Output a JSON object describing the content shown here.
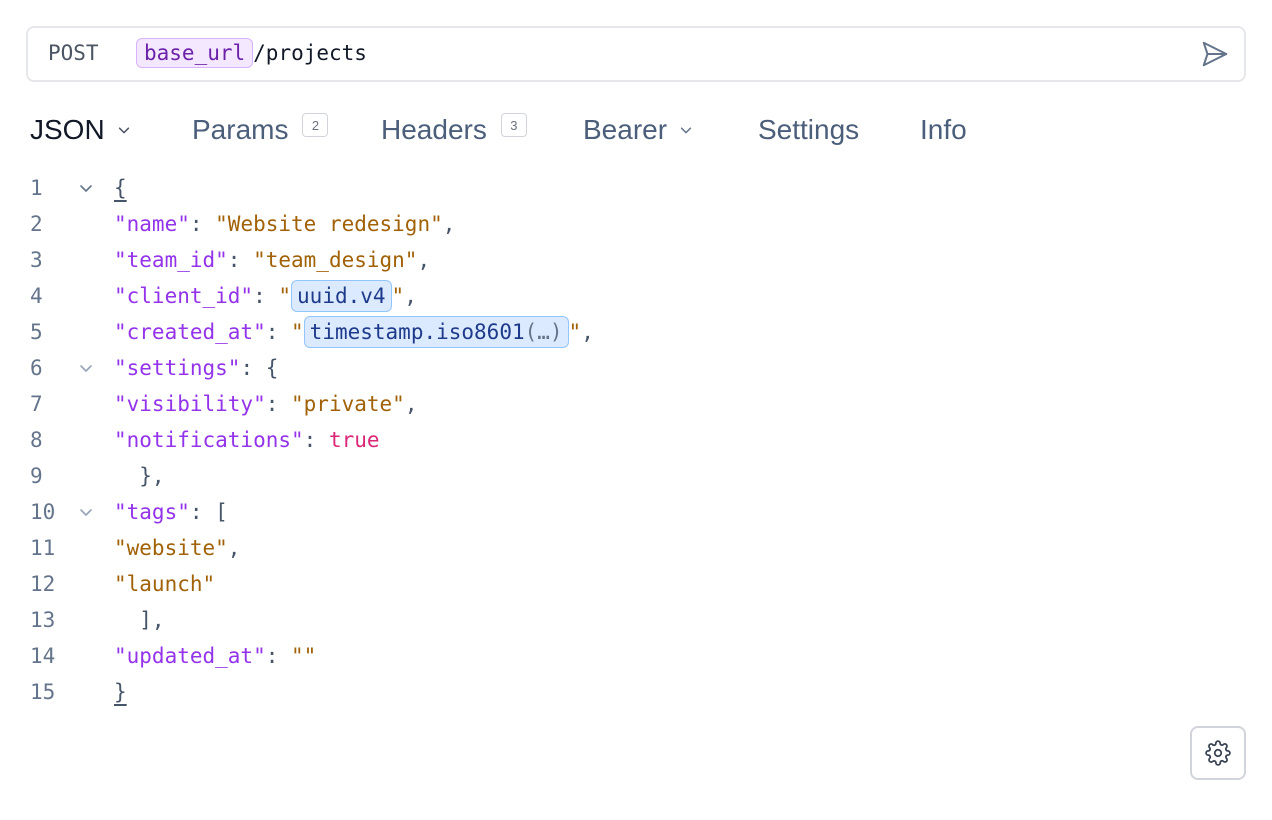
{
  "request": {
    "method": "POST",
    "url_variable": "base_url",
    "url_path": "/projects"
  },
  "tabs": [
    {
      "label": "JSON",
      "active": true,
      "dropdown": true
    },
    {
      "label": "Params",
      "badge": "2"
    },
    {
      "label": "Headers",
      "badge": "3"
    },
    {
      "label": "Bearer",
      "dropdown": true
    },
    {
      "label": "Settings"
    },
    {
      "label": "Info"
    }
  ],
  "editor": {
    "line_numbers": [
      "1",
      "2",
      "3",
      "4",
      "5",
      "6",
      "7",
      "8",
      "9",
      "10",
      "11",
      "12",
      "13",
      "14",
      "15"
    ],
    "keys": {
      "name": "\"name\"",
      "team_id": "\"team_id\"",
      "client_id": "\"client_id\"",
      "created_at": "\"created_at\"",
      "settings": "\"settings\"",
      "visibility": "\"visibility\"",
      "notifications": "\"notifications\"",
      "tags": "\"tags\"",
      "updated_at": "\"updated_at\""
    },
    "values": {
      "name": "\"Website redesign\"",
      "team_id": "\"team_design\"",
      "visibility": "\"private\"",
      "notifications": "true",
      "tag_1": "\"website\"",
      "tag_2": "\"launch\"",
      "updated_at": "\"\""
    },
    "templates": {
      "client_id": "uuid.v4",
      "created_at_fn": "timestamp.iso8601",
      "created_at_args": "(…)"
    }
  },
  "icons": {
    "send": "send-icon",
    "settings": "gear-icon",
    "fold": "chevron-down-icon"
  },
  "colors": {
    "key": "#9333ea",
    "string": "#a16207",
    "boolean": "#db2777",
    "url_variable_bg": "#f3e8ff",
    "template_bg": "#dbeafe"
  }
}
